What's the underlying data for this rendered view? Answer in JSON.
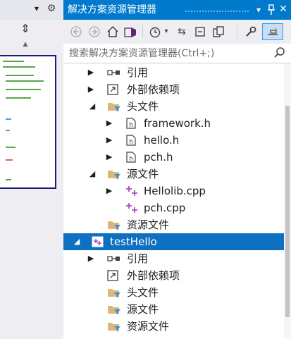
{
  "panel": {
    "title": "解决方案资源管理器",
    "search_placeholder": "搜索解决方案资源管理器(Ctrl+;)"
  },
  "toolbar": {
    "buttons": [
      "back-arrow-icon",
      "forward-arrow-icon",
      "home-icon",
      "vs-solution-icon",
      "history-clock-icon",
      "sync-arrows-icon",
      "collapse-all-icon",
      "copy-views-icon",
      "properties-wrench-icon",
      "preview-selected-icon"
    ]
  },
  "tree": [
    {
      "label": "引用",
      "icon": "references-icon",
      "expander": "collapsed"
    },
    {
      "label": "外部依赖项",
      "icon": "external-dependencies-icon",
      "expander": "collapsed"
    },
    {
      "label": "头文件",
      "icon": "filter-folder-icon",
      "expander": "expanded"
    },
    {
      "label": "framework.h",
      "icon": "header-file-icon",
      "expander": "collapsed"
    },
    {
      "label": "hello.h",
      "icon": "header-file-icon",
      "expander": "collapsed"
    },
    {
      "label": "pch.h",
      "icon": "header-file-icon",
      "expander": "collapsed"
    },
    {
      "label": "源文件",
      "icon": "filter-folder-icon",
      "expander": "expanded"
    },
    {
      "label": "Hellolib.cpp",
      "icon": "cpp-file-icon",
      "expander": "collapsed"
    },
    {
      "label": "pch.cpp",
      "icon": "cpp-file-icon",
      "expander": "none"
    },
    {
      "label": "资源文件",
      "icon": "filter-folder-icon",
      "expander": "none"
    },
    {
      "label": "testHello",
      "icon": "cpp-project-icon",
      "expander": "expanded",
      "selected": true
    },
    {
      "label": "引用",
      "icon": "references-icon",
      "expander": "collapsed"
    },
    {
      "label": "外部依赖项",
      "icon": "external-dependencies-icon",
      "expander": "none"
    },
    {
      "label": "头文件",
      "icon": "filter-folder-icon",
      "expander": "none"
    },
    {
      "label": "源文件",
      "icon": "filter-folder-icon",
      "expander": "none"
    },
    {
      "label": "资源文件",
      "icon": "filter-folder-icon",
      "expander": "none"
    }
  ],
  "colors": {
    "title_bar": "#007acc",
    "selection": "#0e70c0",
    "toolbar_bg": "#eeeef2",
    "folder": "#dcb67a",
    "filter": "#3c8fd7",
    "cpp_plus": "#a74cc6"
  }
}
